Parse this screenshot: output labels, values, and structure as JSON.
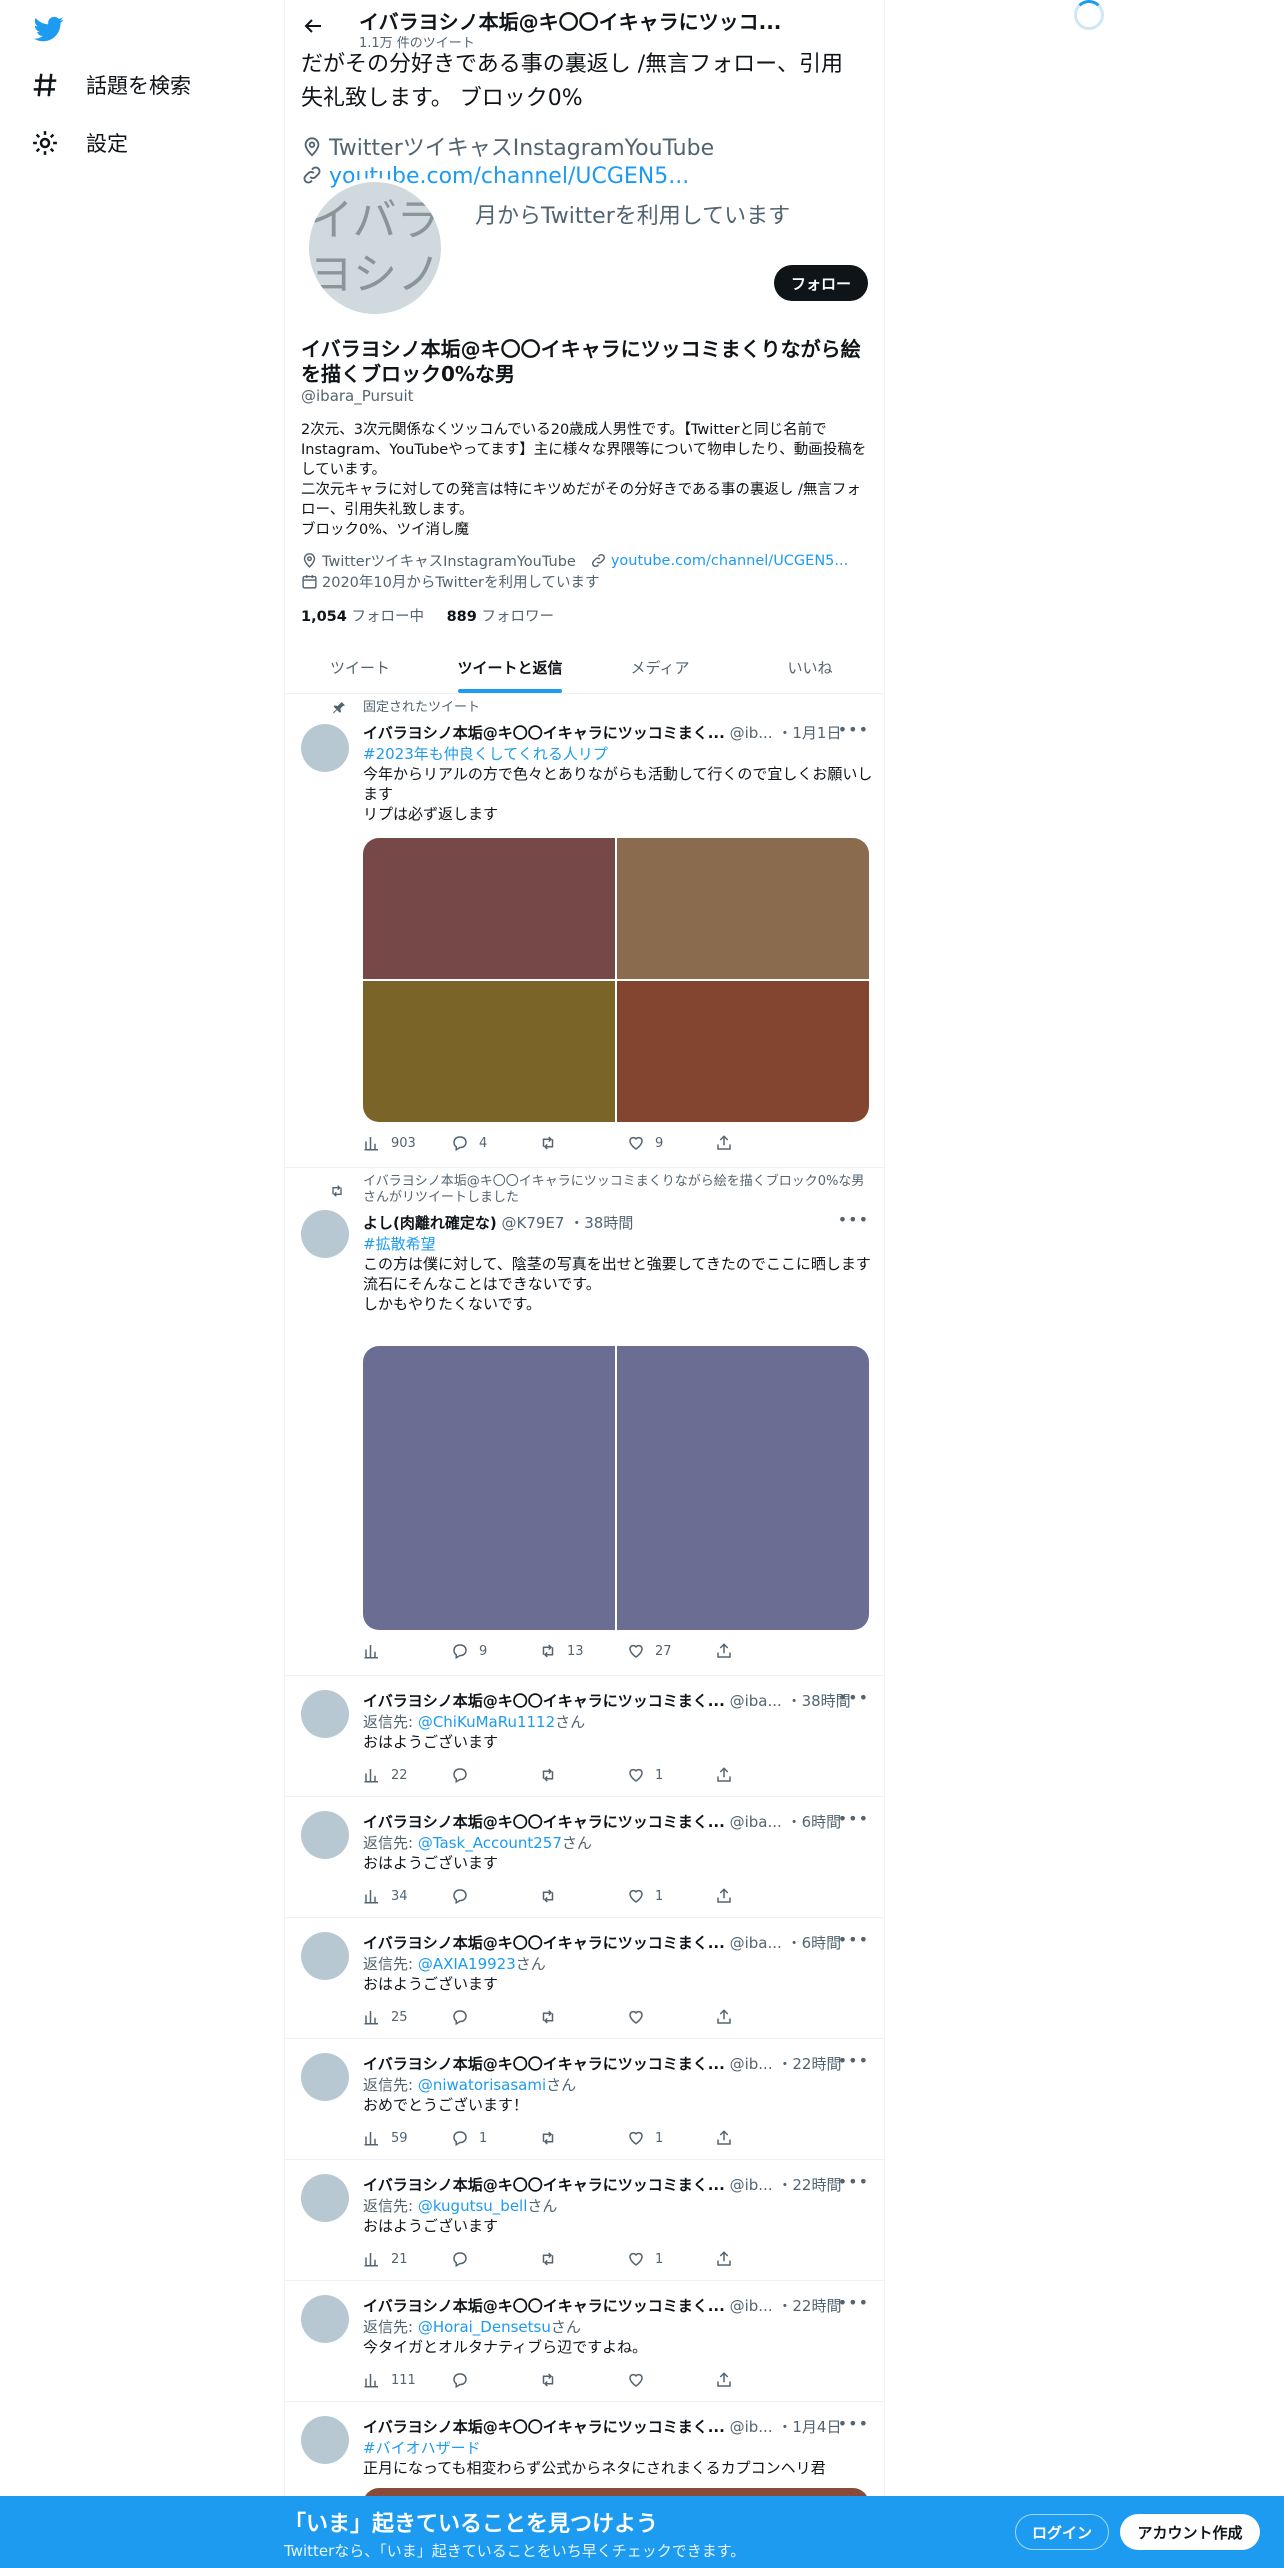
{
  "nav": {
    "explore": "話題を検索",
    "settings": "設定"
  },
  "header": {
    "title": "イバラヨシノ本垢@キ〇〇イキャラにツッコ...",
    "tweet_count": "1.1万 件のツイート"
  },
  "ghost": {
    "line1": "だがその分好きである事の裏返し /無言フォロー、引用",
    "line2": "失礼致します。 ブロック0%",
    "location": "TwitterツイキャスInstagramYouTube",
    "link": "youtube.com/channel/UCGEN5...",
    "joined": "月からTwitterを利用しています"
  },
  "profile": {
    "avatar_text": "イバラ\nヨシノ",
    "follow": "フォロー",
    "name": "イバラヨシノ本垢@キ〇〇イキャラにツッコミまくりながら絵を描くブロック0%な男",
    "handle": "@ibara_Pursuit",
    "bio": "2次元、3次元関係なくツッコんでいる20歳成人男性です。【Twitterと同じ名前でInstagram、YouTubeやってます】主に様々な界隈等について物申したり、動画投稿をしています。\n二次元キャラに対しての発言は特にキツめだがその分好きである事の裏返し /無言フォロー、引用失礼致します。\nブロック0%、ツイ消し魔",
    "location": "TwitterツイキャスInstagramYouTube",
    "url": "youtube.com/channel/UCGEN5...",
    "joined": "2020年10月からTwitterを利用しています",
    "following_count": "1,054",
    "following_label": "フォロー中",
    "followers_count": "889",
    "followers_label": "フォロワー"
  },
  "tabs": [
    "ツイート",
    "ツイートと返信",
    "メディア",
    "いいね"
  ],
  "tweets": {
    "t1": {
      "context": "固定されたツイート",
      "name": "イバラヨシノ本垢@キ〇〇イキャラにツッコミまく...",
      "handle": "@ib...",
      "time": "・1月1日",
      "hashtag": "#2023年も仲良くしてくれる人リプ",
      "text": "今年からリアルの方で色々とありながらも活動して行くので宜しくお願いします\nリプは必ず返します",
      "views": "903",
      "replies": "4",
      "retweets": "",
      "likes": "9",
      "colors": [
        "#774848",
        "#8b6b4e",
        "#7b6428",
        "#834530"
      ]
    },
    "t2": {
      "context": "イバラヨシノ本垢@キ〇〇イキャラにツッコミまくりながら絵を描くブロック0%な男さんがリツイートしました",
      "name": "よし(肉離れ確定な)",
      "handle": "@K79E7",
      "time": "・38時間",
      "hashtag": "#拡散希望",
      "text": "この方は僕に対して、陰茎の写真を出せと強要してきたのでここに晒します\n流石にそんなことはできないです。\nしかもやりたくないです。",
      "views": "",
      "replies": "9",
      "retweets": "13",
      "likes": "27",
      "colors": [
        "#6b6e92",
        "#6b6e92"
      ]
    },
    "t3": {
      "name": "イバラヨシノ本垢@キ〇〇イキャラにツッコミまく...",
      "handle": "@iba...",
      "time": "・38時間",
      "reply_prefix": "返信先: ",
      "reply_to": "@ChiKuMaRu1112",
      "reply_suffix": "さん",
      "text": "おはようございます",
      "views": "22",
      "replies": "",
      "retweets": "",
      "likes": "1"
    },
    "t4": {
      "name": "イバラヨシノ本垢@キ〇〇イキャラにツッコミまく...",
      "handle": "@iba...",
      "time": "・6時間",
      "reply_prefix": "返信先: ",
      "reply_to": "@Task_Account257",
      "reply_suffix": "さん",
      "text": "おはようございます",
      "views": "34",
      "replies": "",
      "retweets": "",
      "likes": "1"
    },
    "t5": {
      "name": "イバラヨシノ本垢@キ〇〇イキャラにツッコミまく...",
      "handle": "@iba...",
      "time": "・6時間",
      "reply_prefix": "返信先: ",
      "reply_to": "@AXIA19923",
      "reply_suffix": "さん",
      "text": "おはようございます",
      "views": "25",
      "replies": "",
      "retweets": "",
      "likes": ""
    },
    "t6": {
      "name": "イバラヨシノ本垢@キ〇〇イキャラにツッコミまく...",
      "handle": "@ib...",
      "time": "・22時間",
      "reply_prefix": "返信先: ",
      "reply_to": "@niwatorisasami",
      "reply_suffix": "さん",
      "text": "おめでとうございます！",
      "views": "59",
      "replies": "1",
      "retweets": "",
      "likes": "1"
    },
    "t7": {
      "name": "イバラヨシノ本垢@キ〇〇イキャラにツッコミまく...",
      "handle": "@ib...",
      "time": "・22時間",
      "reply_prefix": "返信先: ",
      "reply_to": "@kugutsu_bell",
      "reply_suffix": "さん",
      "text": "おはようございます",
      "views": "21",
      "replies": "",
      "retweets": "",
      "likes": "1"
    },
    "t8": {
      "name": "イバラヨシノ本垢@キ〇〇イキャラにツッコミまく...",
      "handle": "@ib...",
      "time": "・22時間",
      "reply_prefix": "返信先: ",
      "reply_to": "@Horai_Densetsu",
      "reply_suffix": "さん",
      "text": "今タイガとオルタナティブら辺ですよね。",
      "views": "111",
      "replies": "",
      "retweets": "",
      "likes": ""
    },
    "t9": {
      "name": "イバラヨシノ本垢@キ〇〇イキャラにツッコミまく...",
      "handle": "@ib...",
      "time": "・1月4日",
      "hashtag": "#バイオハザード",
      "text": "正月になっても相変わらず公式からネタにされまくるカプコンヘリ君"
    }
  },
  "banner": {
    "headline": "「いま」起きていることを見つけよう",
    "sub": "Twitterなら、「いま」起きていることをいち早くチェックできます。",
    "login": "ログイン",
    "signup": "アカウント作成"
  },
  "colors": {
    "accent": "#1d9bf0",
    "banner": "#1d9bf0",
    "text_secondary": "#536471"
  }
}
